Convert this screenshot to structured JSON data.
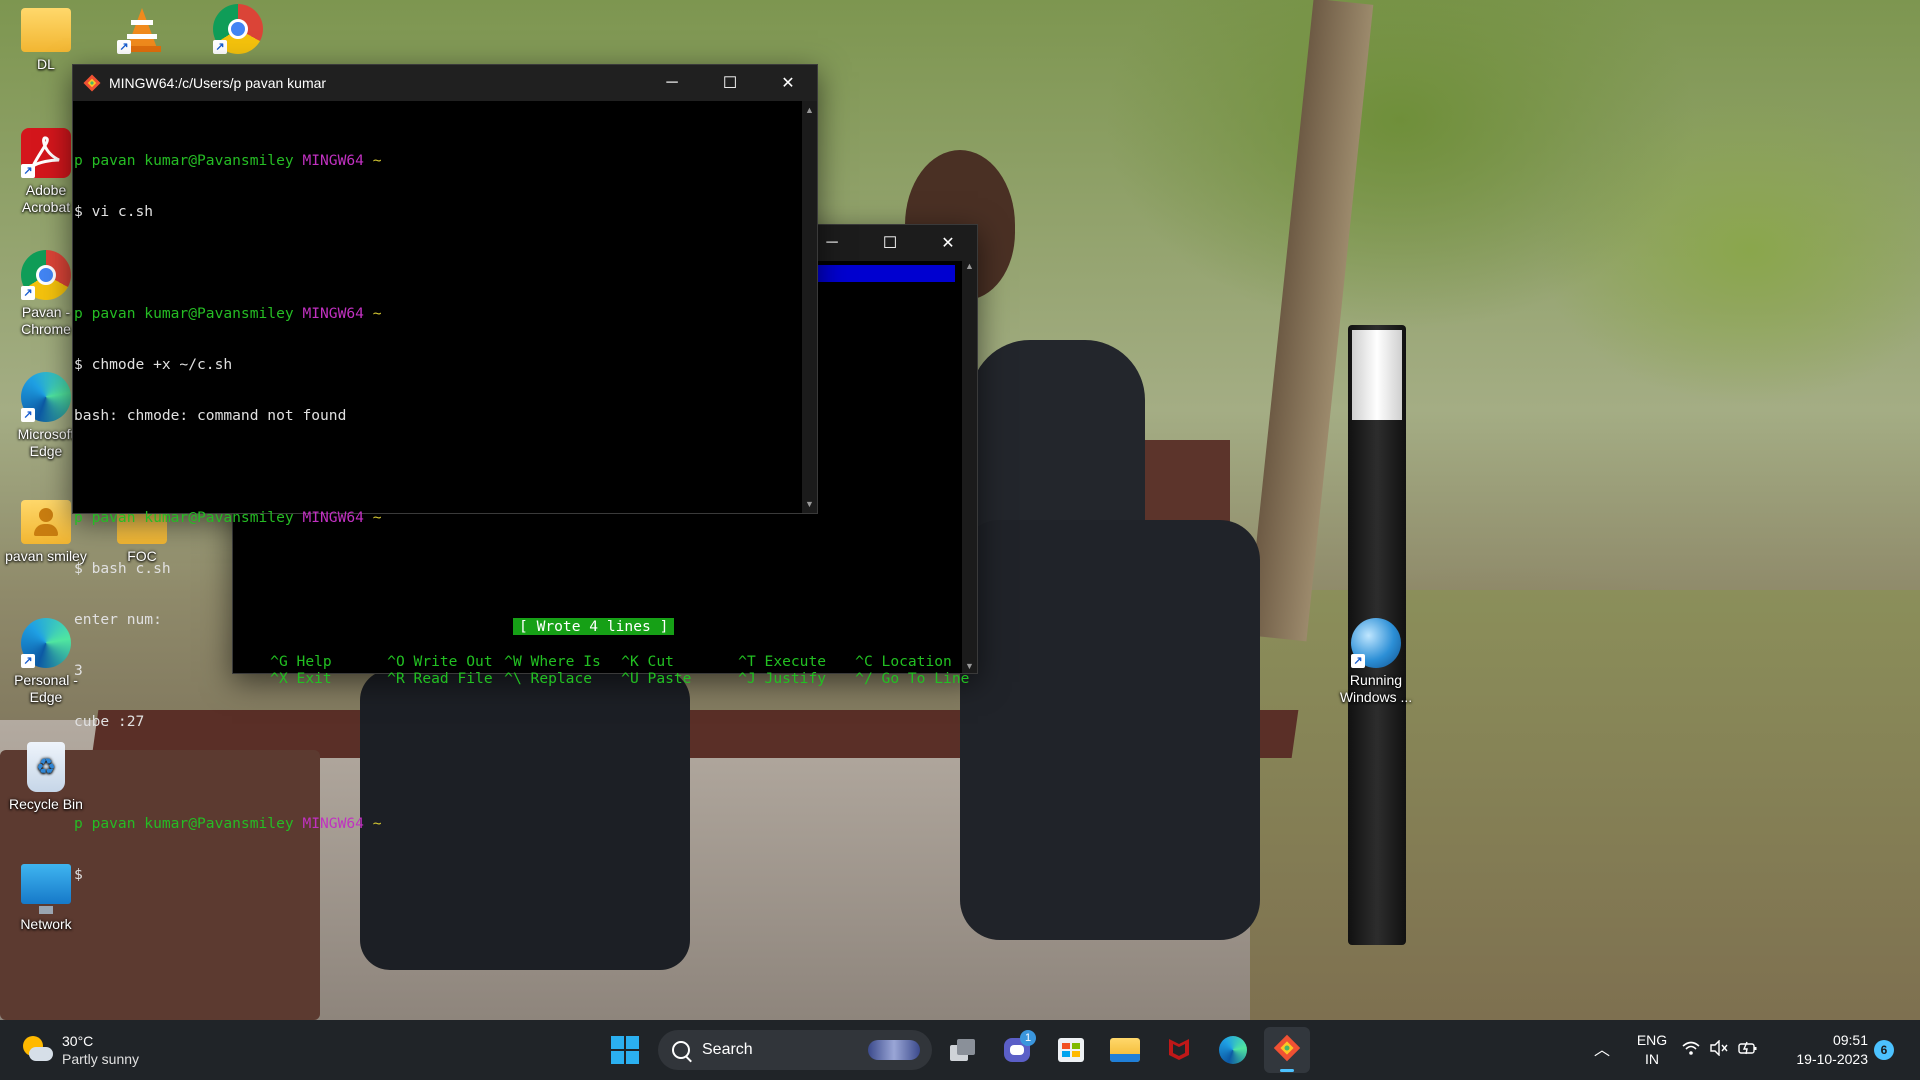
{
  "desktop_icons": [
    {
      "label": "DL",
      "icon": "folder-icon"
    },
    {
      "label": "",
      "icon": "vlc-icon"
    },
    {
      "label": "",
      "icon": "chrome-icon"
    },
    {
      "label": "Adobe Acrobat",
      "icon": "acrobat-icon"
    },
    {
      "label": "Pavan - Chrome",
      "icon": "chrome-icon"
    },
    {
      "label": "Microsoft Edge",
      "icon": "edge-icon"
    },
    {
      "label": "pavan smiley",
      "icon": "user-folder-icon"
    },
    {
      "label": "FOC",
      "icon": "folder-icon"
    },
    {
      "label": "Personal - Edge",
      "icon": "edge-icon"
    },
    {
      "label": "Recycle Bin",
      "icon": "recycle-bin-icon"
    },
    {
      "label": "Network",
      "icon": "network-icon"
    },
    {
      "label": "Running Windows ...",
      "icon": "globe-icon"
    }
  ],
  "terminal": {
    "title": "MINGW64:/c/Users/p pavan kumar",
    "prompt_user": "p pavan kumar@Pavansmiley",
    "prompt_env": "MINGW64",
    "prompt_dir": "~",
    "blocks": [
      {
        "cmd": "$ vi c.sh",
        "output": []
      },
      {
        "cmd": "$ chmode +x ~/c.sh",
        "output": [
          "bash: chmode: command not found"
        ]
      },
      {
        "cmd": "$ bash c.sh",
        "output": [
          "enter num:",
          "3",
          "cube :27"
        ]
      },
      {
        "cmd": "$",
        "output": []
      }
    ]
  },
  "nano_window": {
    "status": "[ Wrote 4 lines ]",
    "shortcuts_row1": [
      {
        "key": "^G",
        "label": "Help"
      },
      {
        "key": "^O",
        "label": "Write Out"
      },
      {
        "key": "^W",
        "label": "Where Is"
      },
      {
        "key": "^K",
        "label": "Cut"
      },
      {
        "key": "^T",
        "label": "Execute"
      },
      {
        "key": "^C",
        "label": "Location"
      }
    ],
    "shortcuts_row2": [
      {
        "key": "^X",
        "label": "Exit"
      },
      {
        "key": "^R",
        "label": "Read File"
      },
      {
        "key": "^\\",
        "label": "Replace"
      },
      {
        "key": "^U",
        "label": "Paste"
      },
      {
        "key": "^J",
        "label": "Justify"
      },
      {
        "key": "^/",
        "label": "Go To Line"
      }
    ]
  },
  "taskbar": {
    "weather_temp": "30°C",
    "weather_desc": "Partly sunny",
    "search_placeholder": "Search",
    "chat_badge": "1",
    "lang_line1": "ENG",
    "lang_line2": "IN",
    "time": "09:51",
    "date": "19-10-2023",
    "notification_count": "6"
  },
  "colors": {
    "prompt_green": "#25bc24",
    "prompt_magenta": "#c131c1",
    "prompt_yellow": "#d4c732",
    "nano_highlight": "#0000d0",
    "nano_status_bg": "#16a016",
    "accent": "#4cc2ff"
  }
}
